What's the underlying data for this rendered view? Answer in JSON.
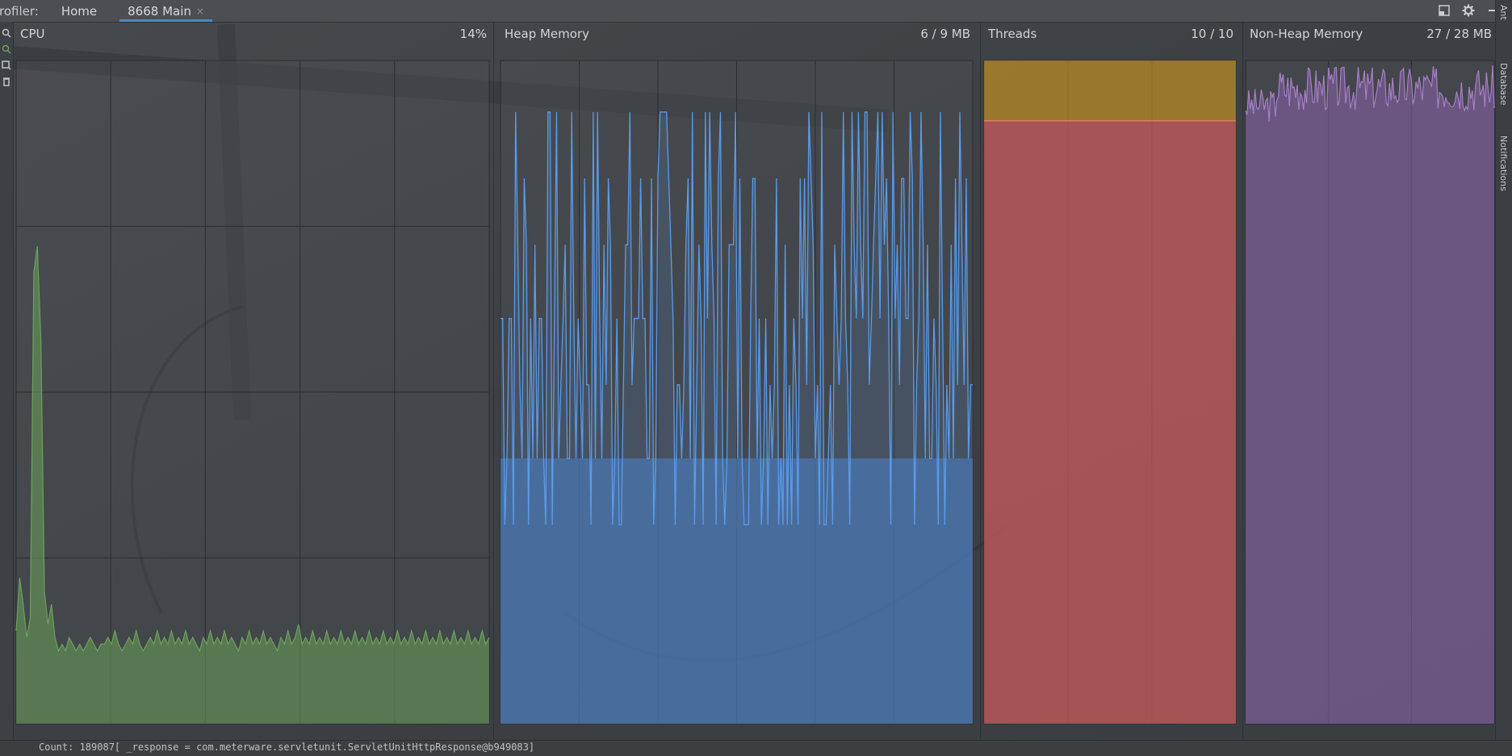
{
  "topbar": {
    "label": "rofiler:",
    "tabs": [
      {
        "label": "Home",
        "active": false
      },
      {
        "label": "8668 Main",
        "active": true,
        "close": "×"
      }
    ],
    "actions": [
      "layout-icon",
      "gear-icon",
      "minimize-icon"
    ]
  },
  "right_rail": {
    "items": [
      "Ant",
      "Database",
      "Notifications"
    ]
  },
  "panels": {
    "cpu": {
      "title": "CPU",
      "value": "14%",
      "color": "#6aa35a"
    },
    "heap": {
      "title": "Heap Memory",
      "value": "6 / 9 MB",
      "color": "#5a9bea"
    },
    "threads": {
      "title": "Threads",
      "value": "10 / 10",
      "color": "#d05a5a",
      "top_color": "#c8921d"
    },
    "nonheap": {
      "title": "Non-Heap Memory",
      "value": "27 / 28 MB",
      "color": "#a77fc6"
    }
  },
  "statusbar": {
    "message": "Count: 189087[ _response = com.meterware.servletunit.ServletUnitHttpResponse@b949083]"
  },
  "chart_data": [
    {
      "type": "area",
      "title": "CPU",
      "ylim": [
        0,
        100
      ],
      "grid": true,
      "values": [
        14,
        22,
        18,
        13,
        16,
        68,
        72,
        58,
        20,
        15,
        18,
        13,
        11,
        12,
        11,
        13,
        12,
        11,
        12,
        11,
        12,
        13,
        12,
        11,
        12,
        12,
        13,
        12,
        14,
        12,
        11,
        12,
        13,
        12,
        14,
        12,
        11,
        12,
        13,
        12,
        14,
        12,
        13,
        12,
        14,
        12,
        13,
        12,
        14,
        12,
        13,
        12,
        11,
        13,
        12,
        14,
        12,
        13,
        12,
        14,
        12,
        13,
        12,
        11,
        13,
        12,
        14,
        12,
        13,
        12,
        14,
        12,
        13,
        12,
        11,
        13,
        12,
        14,
        12,
        13,
        15,
        12,
        13,
        12,
        14,
        12,
        13,
        12,
        14,
        12,
        13,
        12,
        14,
        12,
        13,
        12,
        14,
        12,
        13,
        12,
        14,
        12,
        13,
        12,
        14,
        12,
        13,
        12,
        14,
        12,
        13,
        12,
        14,
        12,
        13,
        12,
        14,
        12,
        13,
        12,
        14,
        12,
        13,
        12,
        14,
        12,
        13,
        12,
        14,
        12,
        13,
        12,
        14,
        12,
        13
      ]
    },
    {
      "type": "area",
      "title": "Heap Memory",
      "ylim": [
        0,
        9
      ],
      "grid": true,
      "levels_mb": [
        2.7,
        3.6,
        4.6,
        5.5,
        6.5,
        7.4,
        8.3
      ]
    },
    {
      "type": "area",
      "title": "Threads",
      "ylim": [
        0,
        11
      ],
      "grid": true,
      "series": [
        {
          "name": "",
          "values": [
            10,
            10
          ]
        },
        {
          "name": "",
          "values": [
            11,
            11
          ]
        }
      ]
    },
    {
      "type": "area",
      "title": "Non-Heap Memory",
      "ylim": [
        0,
        28
      ],
      "grid": true,
      "band": [
        25.4,
        27.8
      ]
    }
  ]
}
